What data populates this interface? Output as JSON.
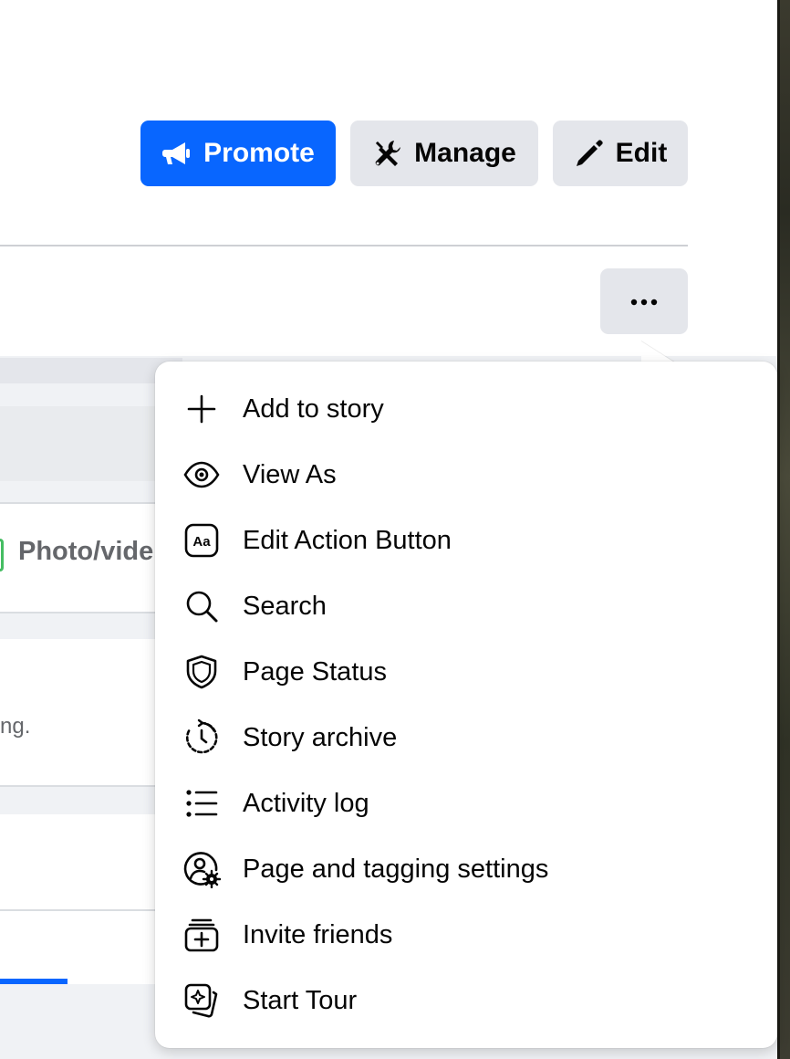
{
  "header": {
    "promote_label": "Promote",
    "manage_label": "Manage",
    "edit_label": "Edit",
    "more_icon": "more-horizontal-icon"
  },
  "feed": {
    "photo_video_label": "Photo/vide",
    "partial_text": "ng."
  },
  "menu": {
    "items": [
      {
        "label": "Add to story",
        "icon": "plus-icon"
      },
      {
        "label": "View As",
        "icon": "eye-icon"
      },
      {
        "label": "Edit Action Button",
        "icon": "text-aa-icon"
      },
      {
        "label": "Search",
        "icon": "search-icon"
      },
      {
        "label": "Page Status",
        "icon": "shield-icon"
      },
      {
        "label": "Story archive",
        "icon": "clock-history-icon"
      },
      {
        "label": "Activity log",
        "icon": "list-icon"
      },
      {
        "label": "Page and tagging settings",
        "icon": "user-gear-icon"
      },
      {
        "label": "Invite friends",
        "icon": "invite-stack-icon"
      },
      {
        "label": "Start Tour",
        "icon": "tour-cards-icon"
      }
    ]
  },
  "colors": {
    "primary_blue": "#0866ff",
    "secondary_button": "#e4e6eb",
    "text_primary": "#050505",
    "text_secondary": "#65676b",
    "background": "#f0f2f5"
  }
}
